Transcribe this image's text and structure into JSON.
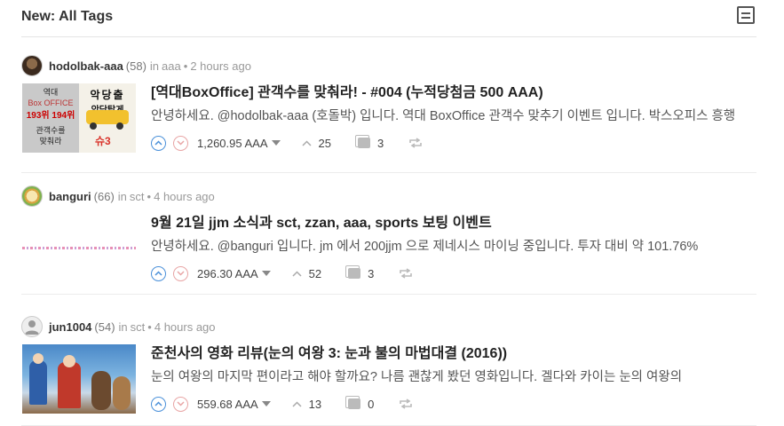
{
  "header": {
    "title": "New: All Tags"
  },
  "posts": [
    {
      "author": "hodolbak-aaa",
      "reputation": "(58)",
      "in_label": "in",
      "category": "aaa",
      "time": "2 hours ago",
      "title": "[역대BoxOffice] 관객수를 맞춰라! - #004 (누적당첨금 500 AAA)",
      "excerpt": "안녕하세요. @hodolbak-aaa (호돌박) 입니다. 역대 BoxOffice 관객수 맞추기 이벤트 입니다. 박스오피스 흥행",
      "payout": "1,260.95 AAA",
      "votes": "25",
      "comments": "3",
      "thumb": {
        "line1": "역대",
        "line2": "Box OFFICE",
        "line3": "193위 194위",
        "line4": "관객수를",
        "line5": "맞춰라",
        "poster": "악당출",
        "poster2": "악당탑게",
        "poster3": "슈3"
      }
    },
    {
      "author": "banguri",
      "reputation": "(66)",
      "in_label": "in",
      "category": "sct",
      "time": "4 hours ago",
      "title": "9월 21일 jjm 소식과 sct, zzan, aaa, sports 보팅 이벤트",
      "excerpt": "안녕하세요. @banguri 입니다. jm 에서 200jjm 으로 제네시스 마이닝 중입니다. 투자 대비 약 101.76%",
      "payout": "296.30 AAA",
      "votes": "52",
      "comments": "3"
    },
    {
      "author": "jun1004",
      "reputation": "(54)",
      "in_label": "in",
      "category": "sct",
      "time": "4 hours ago",
      "title": "준천사의 영화 리뷰(눈의 여왕 3: 눈과 불의 마법대결 (2016))",
      "excerpt": "눈의 여왕의 마지막 편이라고 해야 할까요? 나름 괜찮게 봤던 영화입니다. 겔다와 카이는 눈의 여왕의",
      "payout": "559.68 AAA",
      "votes": "13",
      "comments": "0"
    }
  ]
}
